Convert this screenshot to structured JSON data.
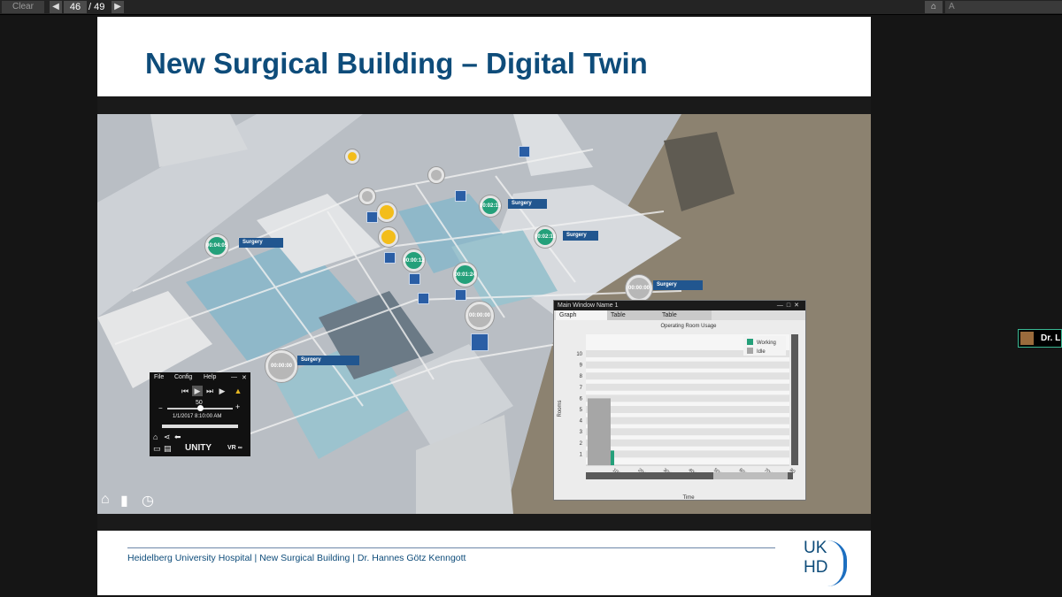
{
  "toolbar": {
    "clear_label": "Clear",
    "prev_icon": "triangle-left-icon",
    "page": "46",
    "total": "/ 49",
    "next_icon": "triangle-right-icon",
    "home_icon": "home-icon",
    "search_value": "A"
  },
  "slide": {
    "title": "New Surgical Building – Digital Twin",
    "footer": "Heidelberg University Hospital | New Surgical Building | Dr. Hannes Götz Kenngott",
    "logo_top": "UK",
    "logo_bottom": "HD",
    "accent_color": "#0e4c7a"
  },
  "scene": {
    "markers": [
      {
        "time": "00:04:05",
        "label": "Surgery",
        "state": "green"
      },
      {
        "time": "00:00:12",
        "label": "",
        "state": "green"
      },
      {
        "time": "00:01:24",
        "label": "",
        "state": "green"
      },
      {
        "time": "00:02:15",
        "label": "Surgery",
        "state": "green"
      },
      {
        "time": "00:02:18",
        "label": "Surgery",
        "state": "green"
      },
      {
        "time": "00:00:00",
        "label": "Surgery",
        "state": "grey"
      },
      {
        "time": "00:00:00",
        "label": "Surgery",
        "state": "grey"
      },
      {
        "time": "00:00:00",
        "label": "",
        "state": "grey"
      }
    ]
  },
  "unity_panel": {
    "menu_file": "File",
    "menu_config": "Config",
    "menu_help": "Help",
    "speed": "50",
    "datetime": "1/1/2017 8:10:00 AM",
    "brand": "UNITY",
    "vr": "VR",
    "play_icon": "play-icon",
    "warning_icon": "warning-icon"
  },
  "bottom_toolbar": {
    "home_icon": "home-icon",
    "chart_icon": "bar-chart-icon",
    "timer_icon": "stopwatch-icon"
  },
  "graph_window": {
    "title": "Main Window Name 1",
    "tab_graph": "Graph",
    "tab_table_1": "Table",
    "tab_table_2": "Table"
  },
  "chart_data": {
    "type": "bar",
    "title": "Operating Room Usage",
    "xlabel": "Time",
    "ylabel": "Rooms",
    "ylim": [
      0,
      10
    ],
    "yticks": [
      "1",
      "2",
      "3",
      "4",
      "5",
      "6",
      "7",
      "8",
      "9",
      "10"
    ],
    "xticks": [
      "10:00",
      "20:00",
      "30:00",
      "40:00",
      "50:00",
      "60:00",
      "70:00",
      "80"
    ],
    "series": [
      {
        "name": "Working",
        "color": "#24a07a",
        "values": [
          1
        ]
      },
      {
        "name": "Idle",
        "color": "#a6a6a6",
        "values": [
          6
        ]
      }
    ],
    "legend": "top-right",
    "grid": true
  },
  "participant": {
    "name": "Dr. L"
  }
}
